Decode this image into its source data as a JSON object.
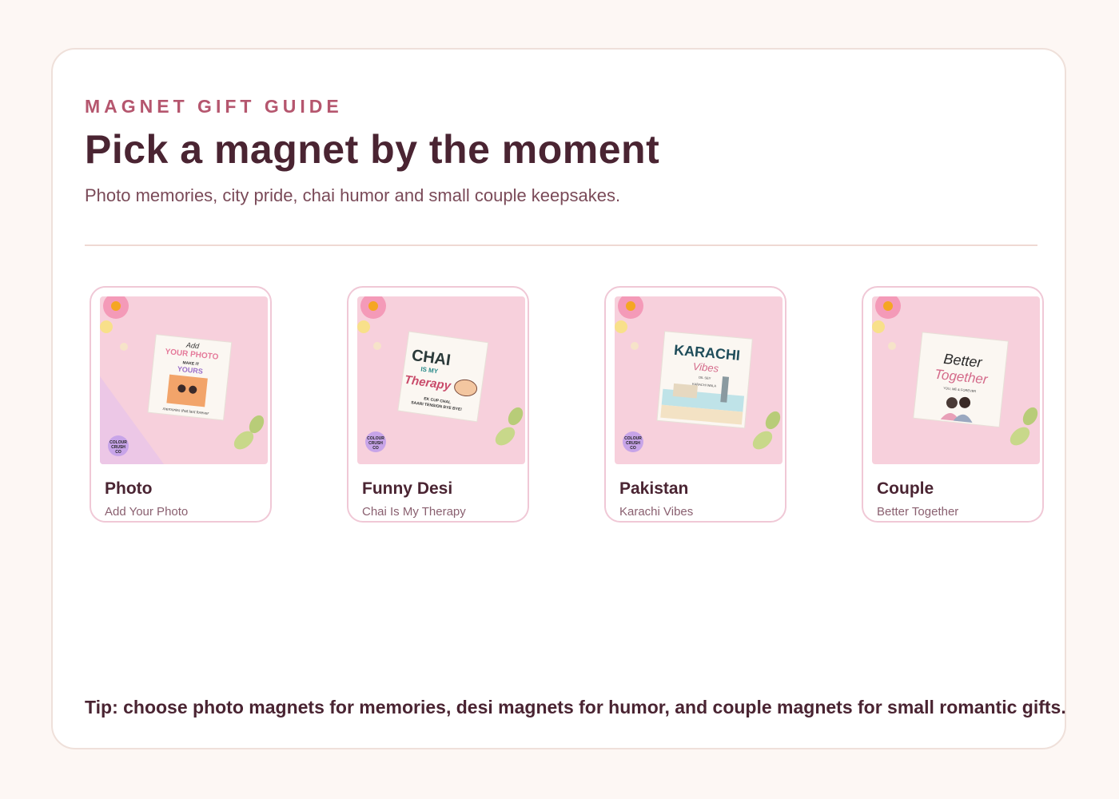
{
  "header": {
    "eyebrow": "MAGNET GIFT GUIDE",
    "title": "Pick a magnet by the moment",
    "subtitle": "Photo memories, city pride, chai humor and small couple keepsakes."
  },
  "cards": [
    {
      "title": "Photo",
      "subtitle": "Add Your Photo",
      "image_text": [
        "Add",
        "YOUR PHOTO",
        "MAKE IT",
        "YOURS",
        "memories that last forever"
      ]
    },
    {
      "title": "Funny Desi",
      "subtitle": "Chai Is My Therapy",
      "image_text": [
        "CHAI",
        "IS MY",
        "Therapy",
        "EK CUP CHAI,",
        "SAARI TENSION BYE BYE!"
      ]
    },
    {
      "title": "Pakistan",
      "subtitle": "Karachi Vibes",
      "image_text": [
        "KARACHI",
        "Vibes",
        "DIL SEY",
        "KARACHI WALA"
      ]
    },
    {
      "title": "Couple",
      "subtitle": "Better Together",
      "image_text": [
        "Better",
        "Together",
        "YOU, ME & FOREVER"
      ]
    }
  ],
  "brand_badge": [
    "COLOUR",
    "CRUSH",
    "CO"
  ],
  "tip": "Tip: choose photo magnets for memories, desi magnets for humor, and couple magnets for small romantic gifts.",
  "colors": {
    "accent": "#b5566e",
    "heading": "#4a2432",
    "card_border": "#f0c8d6",
    "image_bg": "#f7d0dc"
  }
}
